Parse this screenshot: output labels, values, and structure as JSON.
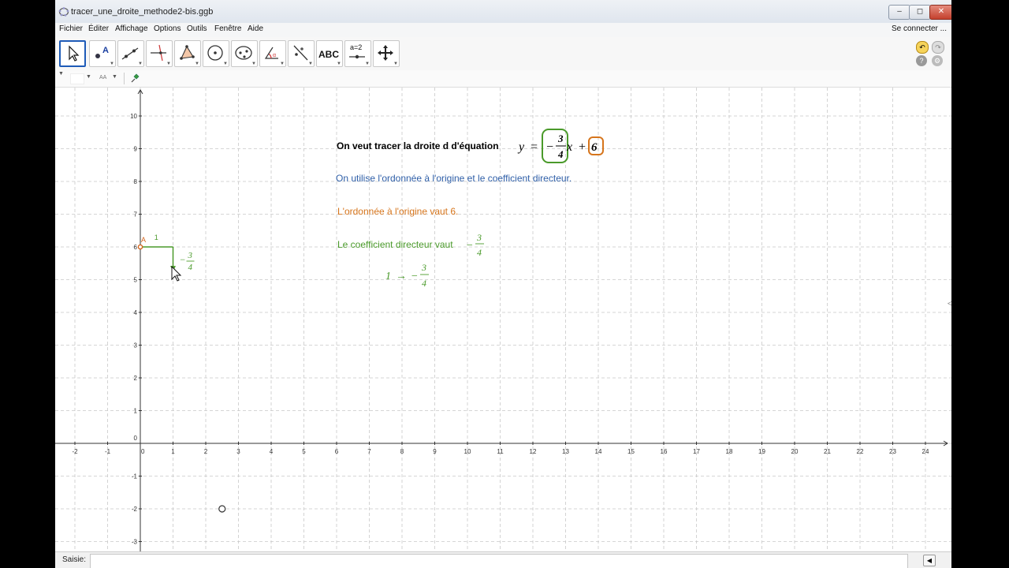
{
  "window": {
    "title": "tracer_une_droite_methode2-bis.ggb",
    "controls": [
      "–",
      "◻",
      "✕"
    ]
  },
  "menu": {
    "items": [
      "Fichier",
      "Éditer",
      "Affichage",
      "Options",
      "Outils",
      "Fenêtre",
      "Aide"
    ],
    "connect": "Se connecter ..."
  },
  "toolbar": {
    "tools": [
      "move-tool",
      "point-tool",
      "line-tool",
      "perpendicular-line-tool",
      "polygon-tool",
      "circle-tool",
      "ellipse-tool",
      "angle-tool",
      "reflect-tool",
      "text-tool",
      "slider-tool",
      "move-view-tool"
    ],
    "text_tool_label": "ABC",
    "slider_tool_label": "a=2"
  },
  "stylebar": {
    "font_size_label": "AA"
  },
  "graph": {
    "x_ticks": [
      "-2",
      "-1",
      "0",
      "1",
      "2",
      "3",
      "4",
      "5",
      "6",
      "7",
      "8",
      "9",
      "10",
      "11",
      "12",
      "13",
      "14",
      "15",
      "16",
      "17",
      "18",
      "19",
      "20",
      "21",
      "22",
      "23",
      "24"
    ],
    "y_ticks": [
      "10",
      "9",
      "8",
      "7",
      "6",
      "5",
      "4",
      "3",
      "2",
      "1",
      "0",
      "-1",
      "-2",
      "-3"
    ],
    "point_label": "A",
    "point_A": {
      "x": 0,
      "y": 6
    },
    "run_label": "1",
    "rise_label": {
      "sign": "−",
      "num": "3",
      "den": "4"
    },
    "open_point": {
      "x": 2.5,
      "y": -2
    },
    "colors": {
      "green": "#4a9a2a",
      "orange": "#d6751c",
      "blue": "#2f5fa8",
      "black": "#000000",
      "point": "#d4661e"
    }
  },
  "text": {
    "intro": "On veut tracer la droite d d'équation",
    "eq": {
      "y": "y",
      "equals": "=",
      "minus": "−",
      "num": "3",
      "den": "4",
      "x": "x",
      "plus": "+",
      "intercept": "6"
    },
    "line2": "On utilise l'ordonnée à l'origine et le coefficient directeur.",
    "line3": "L'ordonnée à l'origine vaut 6.",
    "line4": "Le coefficient directeur vaut",
    "slope": {
      "minus": "−",
      "num": "3",
      "den": "4"
    },
    "map": {
      "from": "1",
      "arrow": "→",
      "minus": "−",
      "num": "3",
      "den": "4"
    }
  },
  "inputbar": {
    "label": "Saisie:",
    "value": ""
  }
}
